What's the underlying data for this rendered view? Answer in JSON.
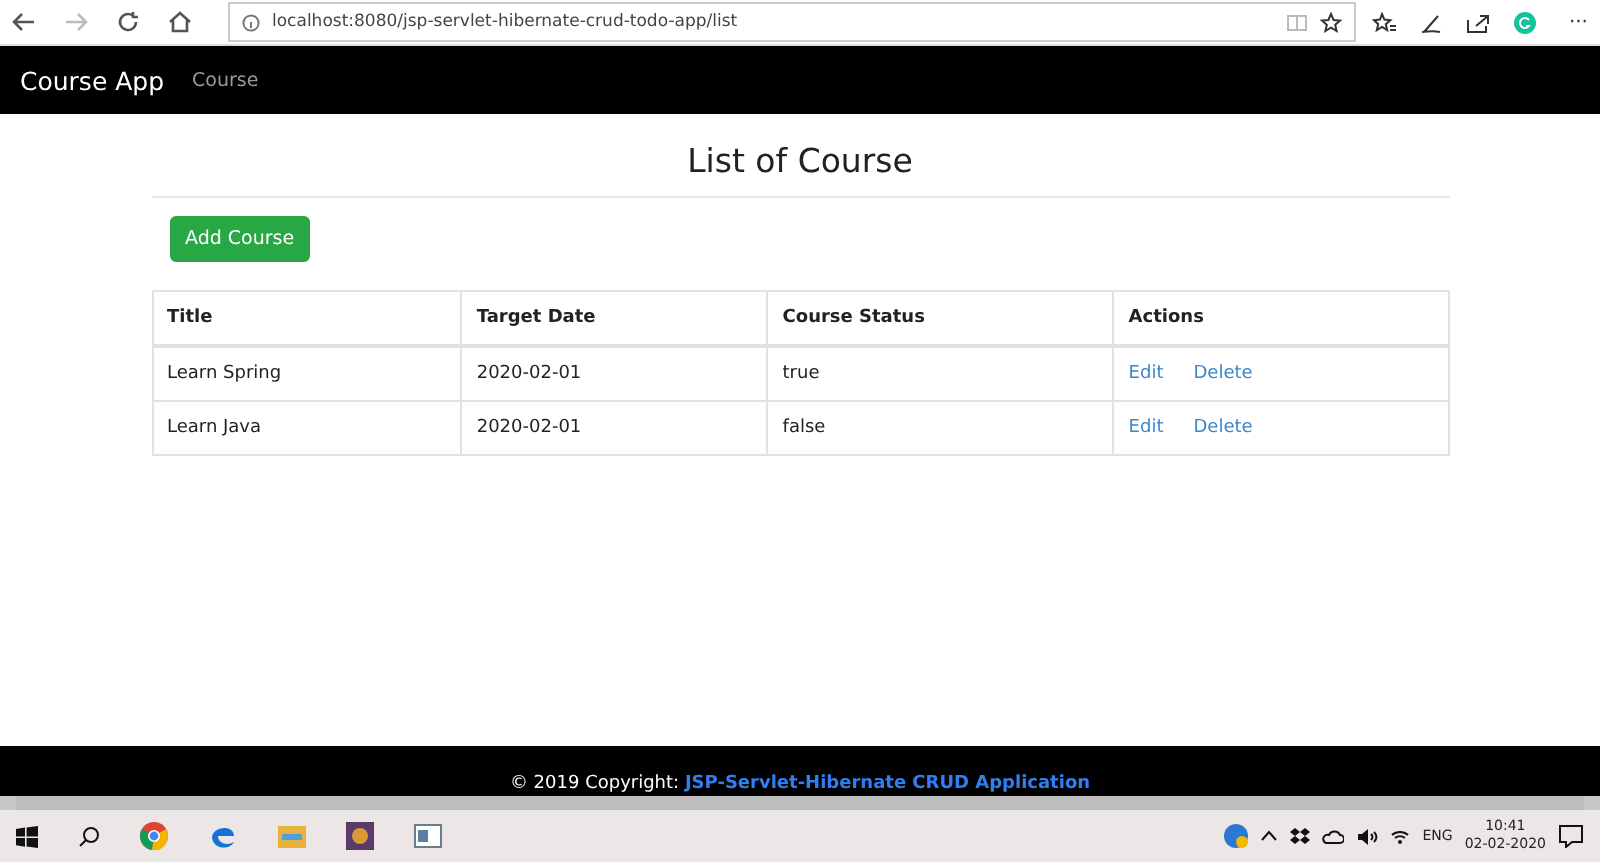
{
  "browser": {
    "url": "localhost:8080/jsp-servlet-hibernate-crud-todo-app/list",
    "more": "···"
  },
  "navbar": {
    "brand": "Course App",
    "links": [
      "Course"
    ]
  },
  "page": {
    "heading": "List of Course",
    "add_button": "Add Course",
    "table": {
      "columns": [
        "Title",
        "Target Date",
        "Course Status",
        "Actions"
      ],
      "rows": [
        {
          "title": "Learn Spring",
          "target_date": "2020-02-01",
          "status": "true",
          "actions": [
            "Edit",
            "Delete"
          ]
        },
        {
          "title": "Learn Java",
          "target_date": "2020-02-01",
          "status": "false",
          "actions": [
            "Edit",
            "Delete"
          ]
        }
      ]
    }
  },
  "footer": {
    "text": "© 2019 Copyright:",
    "link": "JSP-Servlet-Hibernate CRUD Application"
  },
  "taskbar": {
    "language": "ENG",
    "time": "10:41",
    "date": "02-02-2020"
  }
}
